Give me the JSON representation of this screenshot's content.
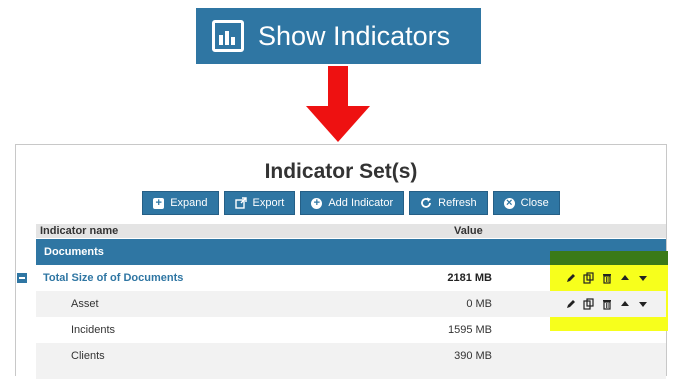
{
  "show_button": {
    "label": "Show Indicators",
    "icon": "bar-chart-icon"
  },
  "panel": {
    "title": "Indicator Set(s)",
    "toolbar": [
      {
        "label": "Expand",
        "icon": "plus-square-icon"
      },
      {
        "label": "Export",
        "icon": "external-link-icon"
      },
      {
        "label": "Add Indicator",
        "icon": "plus-circle-icon"
      },
      {
        "label": "Refresh",
        "icon": "refresh-icon"
      },
      {
        "label": "Close",
        "icon": "close-circle-icon"
      }
    ],
    "columns": {
      "name": "Indicator name",
      "value": "Value"
    },
    "group": "Documents",
    "rows": [
      {
        "name": "Total Size of of Documents",
        "value": "2181 MB"
      },
      {
        "name": "Asset",
        "value": "0 MB"
      },
      {
        "name": "Incidents",
        "value": "1595 MB"
      },
      {
        "name": "Clients",
        "value": "390 MB"
      }
    ],
    "row_actions": [
      "edit-icon",
      "copy-icon",
      "delete-icon",
      "move-up-icon",
      "move-down-icon"
    ]
  },
  "colors": {
    "accent": "#2f76a3",
    "arrow": "#ee1111",
    "highlight": "#f7ff1c",
    "highlight_top": "#3a7a18"
  }
}
